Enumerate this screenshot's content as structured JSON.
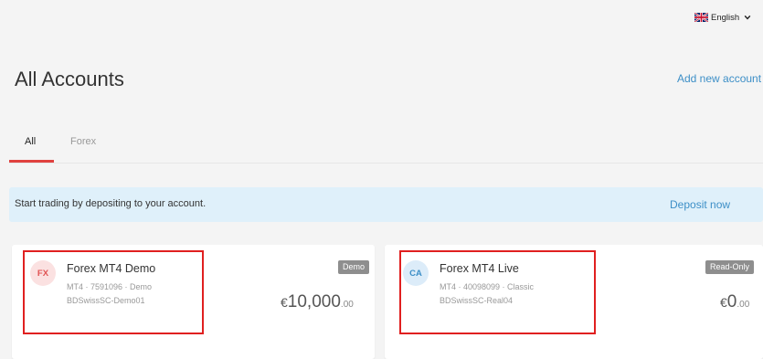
{
  "language": {
    "label": "English",
    "flag_icon": "uk-flag-icon"
  },
  "page": {
    "title": "All Accounts",
    "add_account": "Add new account"
  },
  "tabs": [
    {
      "label": "All",
      "active": true
    },
    {
      "label": "Forex",
      "active": false
    }
  ],
  "banner": {
    "text": "Start trading by depositing to your account.",
    "action": "Deposit now"
  },
  "accounts": [
    {
      "avatar": "FX",
      "name": "Forex MT4 Demo",
      "meta": "MT4 · 7591096 · Demo",
      "server": "BDSwissSC-Demo01",
      "badge": "Demo",
      "currency": "€",
      "balance_int": "10,000",
      "balance_cents": ".00"
    },
    {
      "avatar": "CA",
      "name": "Forex MT4 Live",
      "meta": "MT4 · 40098099 · Classic",
      "server": "BDSwissSC-Real04",
      "badge": "Read-Only",
      "currency": "€",
      "balance_int": "0",
      "balance_cents": ".00"
    }
  ],
  "colors": {
    "accent_red": "#e0413f",
    "link_blue": "#3d8fc7",
    "banner_bg": "#dff0fa",
    "highlight": "#e02020"
  }
}
